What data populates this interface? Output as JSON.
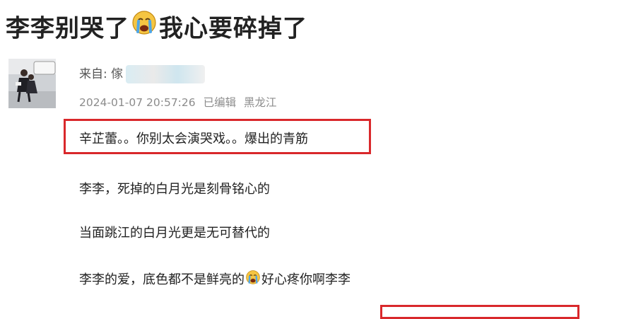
{
  "post": {
    "title_part1": "李李别哭了",
    "title_part2": "我心要碎掉了",
    "from_label": "来自: ",
    "from_name_visible": "傢",
    "timestamp": "2024-01-07 20:57:26",
    "edited": "已编辑",
    "location": "黑龙江"
  },
  "content": {
    "line1": "辛芷蕾。。你别太会演哭戏。。爆出的青筋",
    "line2": "李李，死掉的白月光是刻骨铭心的",
    "line3": "当面跳江的白月光更是无可替代的",
    "line4_before_emoji": "李李的爱，底色都不是鲜亮的",
    "line4_after_emoji": "好心疼你啊李李"
  },
  "icons": {
    "title_emoji": "crying-face-icon",
    "inline_emoji": "crying-face-icon"
  },
  "colors": {
    "highlight_box": "#d9282b",
    "meta_text": "#8c8c8c"
  }
}
